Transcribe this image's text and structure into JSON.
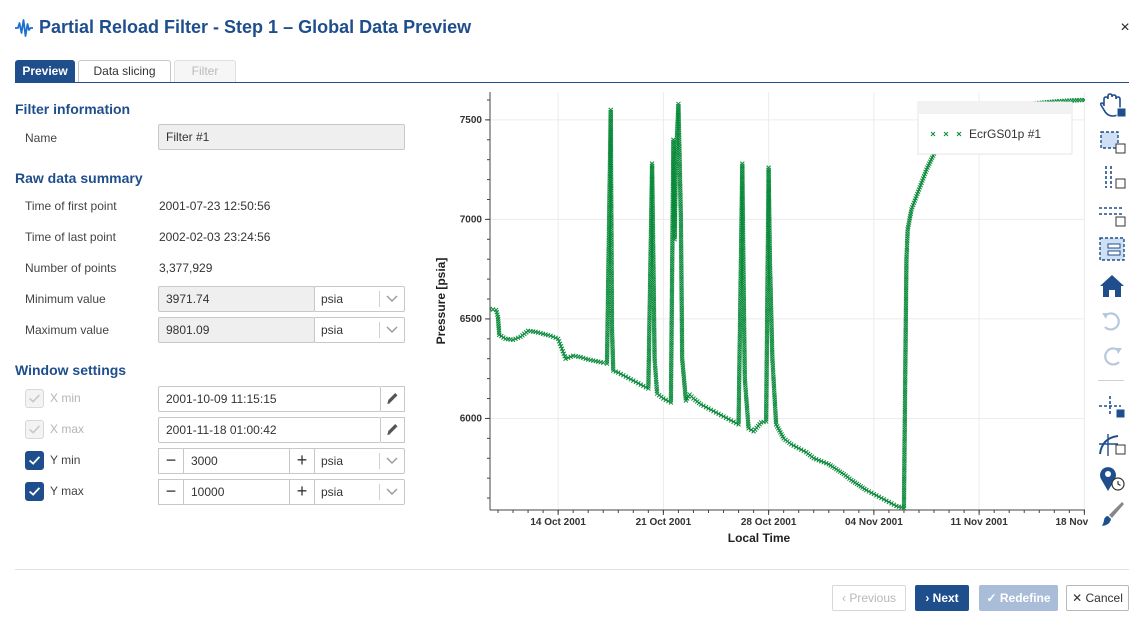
{
  "window": {
    "title": "Partial Reload Filter - Step 1 – Global Data Preview",
    "close_glyph": "×",
    "icon": "waveform-icon"
  },
  "tabs": [
    {
      "label": "Preview",
      "active": true
    },
    {
      "label": "Data slicing",
      "active": false
    },
    {
      "label": "Filter",
      "active": false,
      "disabled": true
    }
  ],
  "filter_info": {
    "heading": "Filter information",
    "name_label": "Name",
    "name_value": "Filter #1"
  },
  "raw_summary": {
    "heading": "Raw data summary",
    "first_label": "Time of first point",
    "first_value": "2001-07-23 12:50:56",
    "last_label": "Time of last point",
    "last_value": "2002-02-03 23:24:56",
    "count_label": "Number of points",
    "count_value": "3,377,929",
    "min_label": "Minimum value",
    "min_value": "3971.74",
    "min_unit": "psia",
    "max_label": "Maximum value",
    "max_value": "9801.09",
    "max_unit": "psia"
  },
  "window_settings": {
    "heading": "Window settings",
    "xmin_label": "X min",
    "xmin_value": "2001-10-09 11:15:15",
    "xmin_checked": true,
    "xmin_enabled": false,
    "xmax_label": "X max",
    "xmax_value": "2001-11-18 01:00:42",
    "xmax_checked": true,
    "xmax_enabled": false,
    "ymin_label": "Y min",
    "ymin_value": "3000",
    "ymin_unit": "psia",
    "ymin_checked": true,
    "ymax_label": "Y max",
    "ymax_value": "10000",
    "ymax_unit": "psia",
    "ymax_checked": true,
    "minus_glyph": "−",
    "plus_glyph": "+"
  },
  "chart_data": {
    "type": "scatter",
    "title": "",
    "xlabel": "Local Time",
    "ylabel": "Pressure [psia]",
    "x_tick_labels": [
      "14 Oct 2001",
      "21 Oct 2001",
      "28 Oct 2001",
      "04 Nov 2001",
      "11 Nov 2001",
      "18 Nov 2001"
    ],
    "x_tick_dates": [
      "2001-10-14",
      "2001-10-21",
      "2001-10-28",
      "2001-11-04",
      "2001-11-11",
      "2001-11-18"
    ],
    "xlim": [
      "2001-10-09 11:15",
      "2001-11-18 01:00"
    ],
    "y_ticks": [
      6000,
      6500,
      7000,
      7500
    ],
    "ylim": [
      5540,
      7640
    ],
    "grid": true,
    "legend_position": "top-right",
    "marker": "x",
    "color": "#0a8a3a",
    "series": [
      {
        "name": "EcrGS01p #1",
        "points": [
          [
            "2001-10-09 11:00",
            6550
          ],
          [
            "2001-10-09 21:00",
            6545
          ],
          [
            "2001-10-10 00:00",
            6510
          ],
          [
            "2001-10-10 02:00",
            6420
          ],
          [
            "2001-10-10 12:00",
            6400
          ],
          [
            "2001-10-11 00:00",
            6395
          ],
          [
            "2001-10-11 12:00",
            6410
          ],
          [
            "2001-10-12 00:00",
            6440
          ],
          [
            "2001-10-12 12:00",
            6435
          ],
          [
            "2001-10-13 00:00",
            6425
          ],
          [
            "2001-10-13 12:00",
            6415
          ],
          [
            "2001-10-14 00:00",
            6400
          ],
          [
            "2001-10-14 06:00",
            6350
          ],
          [
            "2001-10-14 12:00",
            6300
          ],
          [
            "2001-10-15 00:00",
            6315
          ],
          [
            "2001-10-15 12:00",
            6308
          ],
          [
            "2001-10-16 00:00",
            6296
          ],
          [
            "2001-10-16 12:00",
            6288
          ],
          [
            "2001-10-17 00:00",
            6280
          ],
          [
            "2001-10-17 06:00",
            6275
          ],
          [
            "2001-10-17 12:00",
            7550
          ],
          [
            "2001-10-17 13:00",
            7000
          ],
          [
            "2001-10-17 14:00",
            6450
          ],
          [
            "2001-10-17 16:00",
            6240
          ],
          [
            "2001-10-18 00:00",
            6230
          ],
          [
            "2001-10-18 12:00",
            6210
          ],
          [
            "2001-10-19 00:00",
            6190
          ],
          [
            "2001-10-19 12:00",
            6170
          ],
          [
            "2001-10-20 00:00",
            6150
          ],
          [
            "2001-10-20 06:00",
            7280
          ],
          [
            "2001-10-20 08:00",
            6800
          ],
          [
            "2001-10-20 10:00",
            6300
          ],
          [
            "2001-10-20 14:00",
            6125
          ],
          [
            "2001-10-21 00:00",
            6100
          ],
          [
            "2001-10-21 12:00",
            6080
          ],
          [
            "2001-10-21 16:00",
            7400
          ],
          [
            "2001-10-21 18:00",
            6900
          ],
          [
            "2001-10-21 20:00",
            7300
          ],
          [
            "2001-10-22 00:00",
            7580
          ],
          [
            "2001-10-22 04:00",
            7000
          ],
          [
            "2001-10-22 06:00",
            6300
          ],
          [
            "2001-10-22 12:00",
            6090
          ],
          [
            "2001-10-22 18:00",
            6120
          ],
          [
            "2001-10-23 00:00",
            6100
          ],
          [
            "2001-10-23 12:00",
            6070
          ],
          [
            "2001-10-24 00:00",
            6050
          ],
          [
            "2001-10-24 12:00",
            6030
          ],
          [
            "2001-10-25 00:00",
            6010
          ],
          [
            "2001-10-25 12:00",
            5990
          ],
          [
            "2001-10-26 00:00",
            5970
          ],
          [
            "2001-10-26 06:00",
            7280
          ],
          [
            "2001-10-26 08:00",
            6700
          ],
          [
            "2001-10-26 10:00",
            6200
          ],
          [
            "2001-10-26 16:00",
            5950
          ],
          [
            "2001-10-27 00:00",
            5935
          ],
          [
            "2001-10-27 12:00",
            5980
          ],
          [
            "2001-10-27 20:00",
            5985
          ],
          [
            "2001-10-28 00:00",
            7260
          ],
          [
            "2001-10-28 02:00",
            6800
          ],
          [
            "2001-10-28 06:00",
            6300
          ],
          [
            "2001-10-28 12:00",
            5970
          ],
          [
            "2001-10-29 00:00",
            5900
          ],
          [
            "2001-10-29 12:00",
            5870
          ],
          [
            "2001-10-30 00:00",
            5850
          ],
          [
            "2001-10-30 12:00",
            5830
          ],
          [
            "2001-10-31 00:00",
            5800
          ],
          [
            "2001-10-31 12:00",
            5785
          ],
          [
            "2001-11-01 00:00",
            5770
          ],
          [
            "2001-11-01 12:00",
            5745
          ],
          [
            "2001-11-02 00:00",
            5720
          ],
          [
            "2001-11-02 12:00",
            5690
          ],
          [
            "2001-11-03 00:00",
            5665
          ],
          [
            "2001-11-03 12:00",
            5640
          ],
          [
            "2001-11-04 00:00",
            5620
          ],
          [
            "2001-11-04 12:00",
            5600
          ],
          [
            "2001-11-05 00:00",
            5580
          ],
          [
            "2001-11-05 12:00",
            5560
          ],
          [
            "2001-11-06 00:00",
            5550
          ],
          [
            "2001-11-06 02:00",
            6200
          ],
          [
            "2001-11-06 04:00",
            6800
          ],
          [
            "2001-11-06 06:00",
            6950
          ],
          [
            "2001-11-06 12:00",
            7050
          ],
          [
            "2001-11-07 00:00",
            7150
          ],
          [
            "2001-11-07 12:00",
            7250
          ],
          [
            "2001-11-08 00:00",
            7330
          ],
          [
            "2001-11-08 12:00",
            7380
          ],
          [
            "2001-11-09 00:00",
            7420
          ],
          [
            "2001-11-10 00:00",
            7470
          ],
          [
            "2001-11-11 00:00",
            7510
          ],
          [
            "2001-11-12 00:00",
            7540
          ],
          [
            "2001-11-13 00:00",
            7560
          ],
          [
            "2001-11-14 00:00",
            7575
          ],
          [
            "2001-11-15 00:00",
            7585
          ],
          [
            "2001-11-16 00:00",
            7592
          ],
          [
            "2001-11-17 00:00",
            7597
          ],
          [
            "2001-11-18 00:00",
            7600
          ]
        ]
      }
    ]
  },
  "toolbar": {
    "tools": [
      "pan-icon",
      "box-zoom-icon",
      "x-zoom-icon",
      "y-zoom-icon",
      "xy-box-select-icon",
      "reset-home-icon",
      "undo-icon",
      "redo-icon",
      "crosshair-icon",
      "curve-tap-icon",
      "location-time-icon",
      "paintbrush-icon"
    ]
  },
  "footer": {
    "prev_label": "Previous",
    "next_label": "Next",
    "redefine_label": "Redefine",
    "cancel_label": "Cancel",
    "prev_glyph": "‹",
    "next_glyph": "›",
    "check_glyph": "✓",
    "cancel_glyph": "✕"
  },
  "colors": {
    "accent": "#1f4e8c",
    "series": "#0a8a3a",
    "disabled_button": "#a9bcd8"
  }
}
